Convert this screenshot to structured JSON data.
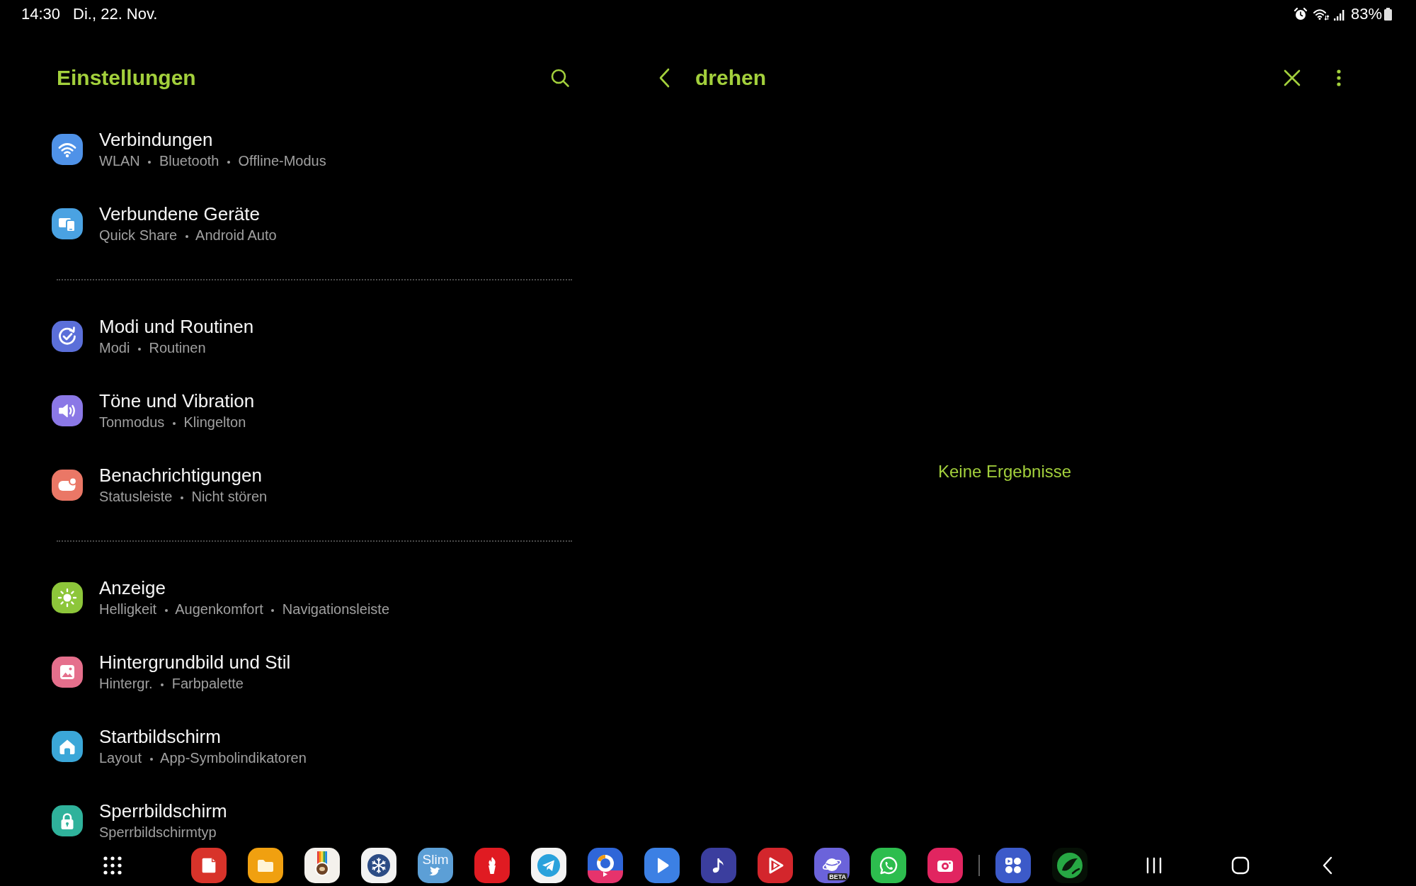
{
  "status_bar": {
    "time": "14:30",
    "date": "Di., 22. Nov.",
    "battery": "83%"
  },
  "settings_pane": {
    "title": "Einstellungen",
    "sections": [
      {
        "items": [
          {
            "title": "Verbindungen",
            "details": [
              "WLAN",
              "Bluetooth",
              "Offline-Modus"
            ],
            "kind": "wifi",
            "color": "#4f92e8"
          },
          {
            "title": "Verbundene Geräte",
            "details": [
              "Quick Share",
              "Android Auto"
            ],
            "kind": "devices",
            "color": "#4aa2e2"
          }
        ]
      },
      {
        "items": [
          {
            "title": "Modi und Routinen",
            "details": [
              "Modi",
              "Routinen"
            ],
            "kind": "check-cycle",
            "color": "#5b6fd9"
          },
          {
            "title": "Töne und Vibration",
            "details": [
              "Tonmodus",
              "Klingelton"
            ],
            "kind": "speaker",
            "color": "#8b78e6"
          },
          {
            "title": "Benachrichtigungen",
            "details": [
              "Statusleiste",
              "Nicht stören"
            ],
            "kind": "bubble",
            "color": "#ea7766"
          }
        ]
      },
      {
        "items": [
          {
            "title": "Anzeige",
            "details": [
              "Helligkeit",
              "Augenkomfort",
              "Navigationsleiste"
            ],
            "kind": "sun",
            "color": "#8dc63a"
          },
          {
            "title": "Hintergrundbild und Stil",
            "details": [
              "Hintergr.",
              "Farbpalette"
            ],
            "kind": "picture",
            "color": "#e56f8c"
          },
          {
            "title": "Startbildschirm",
            "details": [
              "Layout",
              "App-Symbolindikatoren"
            ],
            "kind": "house",
            "color": "#3ba7d8"
          },
          {
            "title": "Sperrbildschirm",
            "details": [
              "Sperrbildschirmtyp"
            ],
            "kind": "lock",
            "color": "#2fb29b"
          }
        ]
      }
    ]
  },
  "search_pane": {
    "query": "drehen",
    "message": "Keine Ergebnisse"
  },
  "taskbar": {
    "pinned": [
      {
        "kind": "note"
      },
      {
        "kind": "folder"
      },
      {
        "kind": "coffee"
      },
      {
        "kind": "snowflake"
      },
      {
        "kind": "bird",
        "label": "Slim"
      },
      {
        "kind": "torch"
      },
      {
        "kind": "paper-plane"
      },
      {
        "kind": "ring"
      },
      {
        "kind": "play"
      },
      {
        "kind": "music-note"
      },
      {
        "kind": "play-outline"
      },
      {
        "kind": "planet",
        "label": "BETA"
      },
      {
        "kind": "phone-bubble"
      },
      {
        "kind": "camera"
      }
    ],
    "recent": [
      {
        "kind": "squares"
      },
      {
        "kind": "leaf"
      }
    ]
  }
}
